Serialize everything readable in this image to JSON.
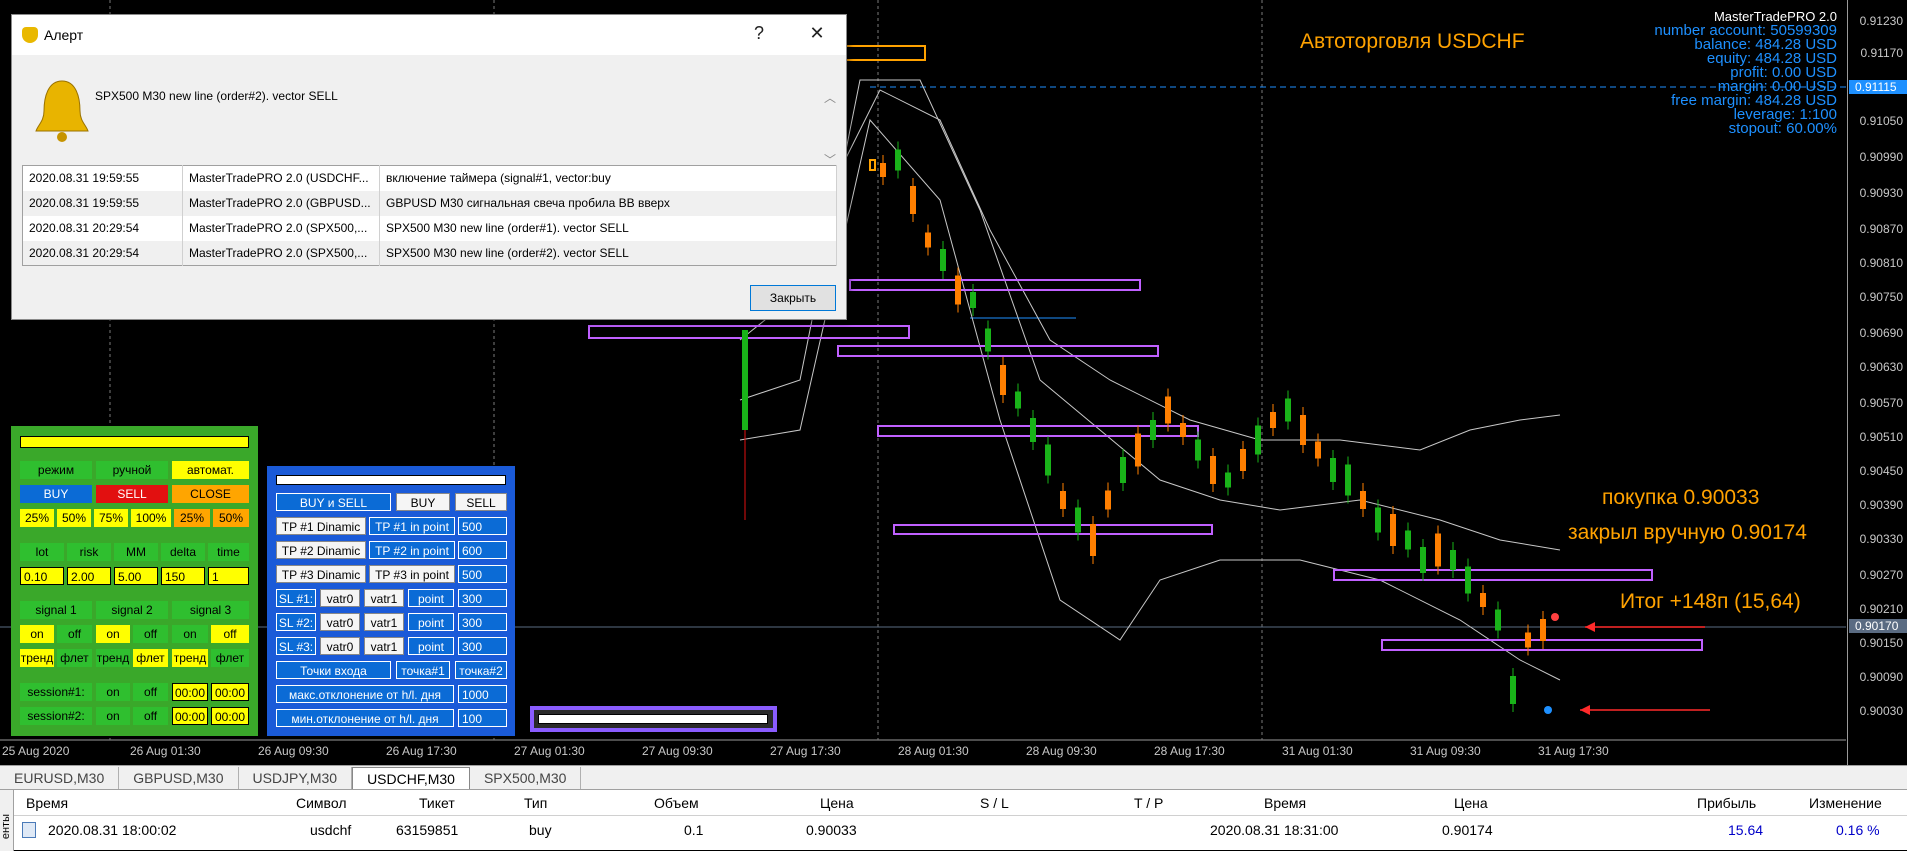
{
  "chart": {
    "title_overlay": "Автоторговля USDCHF",
    "window_title_fragment": "USDCHF,M30",
    "price_labels": [
      "0.91230",
      "0.91170",
      "0.91115",
      "0.91050",
      "0.90990",
      "0.90930",
      "0.90870",
      "0.90810",
      "0.90750",
      "0.90690",
      "0.90630",
      "0.90570",
      "0.90510",
      "0.90450",
      "0.90390",
      "0.90330",
      "0.90270",
      "0.90210",
      "0.90170",
      "0.90150",
      "0.90090",
      "0.90030"
    ],
    "price_marker_top": "0.91115",
    "price_marker_bottom": "0.90170",
    "time_labels": [
      "25 Aug 2020",
      "26 Aug 01:30",
      "26 Aug 09:30",
      "26 Aug 17:30",
      "27 Aug 01:30",
      "27 Aug 09:30",
      "27 Aug 17:30",
      "28 Aug 01:30",
      "28 Aug 09:30",
      "28 Aug 17:30",
      "31 Aug 01:30",
      "31 Aug 09:30",
      "31 Aug 17:30"
    ],
    "annotations": {
      "buy": "покупка 0.90033",
      "closed": "закрыл вручную 0.90174",
      "result": "Итог +148п (15,64)"
    },
    "colors": {
      "bull": "#19b319",
      "bear": "#ff7f00",
      "zone": "#c060ff",
      "band": "#c8c8c8",
      "overlay": "#ffa200",
      "info": "#1e90ff"
    }
  },
  "account": {
    "header": "MasterTradePRO 2.0",
    "lines": [
      "number account: 50599309",
      "balance: 484.28 USD",
      "equity: 484.28 USD",
      "profit: 0.00 USD",
      "margin: 0.00 USD",
      "free margin: 484.28 USD",
      "leverage: 1:100",
      "stopout: 60.00%"
    ]
  },
  "alert_dialog": {
    "title": "Алерт",
    "help": "?",
    "close": "✕",
    "message": "SPX500 M30 new line (order#2). vector SELL",
    "rows": [
      [
        "2020.08.31 19:59:55",
        "MasterTradePRO 2.0 (USDCHF...",
        "включение таймера (signal#1, vector:buy"
      ],
      [
        "2020.08.31 19:59:55",
        "MasterTradePRO 2.0 (GBPUSD...",
        "GBPUSD M30 сигнальная свеча пробила BB вверх"
      ],
      [
        "2020.08.31 20:29:54",
        "MasterTradePRO 2.0 (SPX500,...",
        "SPX500 M30 new line (order#1). vector SELL"
      ],
      [
        "2020.08.31 20:29:54",
        "MasterTradePRO 2.0 (SPX500,...",
        "SPX500 M30 new line (order#2). vector SELL"
      ]
    ],
    "close_button": "Закрыть"
  },
  "left_panel": {
    "mode": [
      "режим",
      "ручной",
      "автомат."
    ],
    "actions": [
      "BUY",
      "SELL",
      "CLOSE"
    ],
    "pct": [
      "25%",
      "50%",
      "75%",
      "100%",
      "25%",
      "50%"
    ],
    "params_labels": [
      "lot",
      "risk",
      "MM",
      "delta",
      "time"
    ],
    "params_values": [
      "0.10",
      "2.00",
      "5.00",
      "150",
      "1"
    ],
    "signals": [
      "signal 1",
      "signal 2",
      "signal 3"
    ],
    "on": "on",
    "off": "off",
    "trend": "тренд",
    "flat": "флет",
    "sessions": [
      "session#1:",
      "session#2:"
    ],
    "time_zero": "00:00"
  },
  "right_panel": {
    "top_buttons": [
      "BUY и SELL",
      "BUY",
      "SELL"
    ],
    "tp_rows": [
      [
        "TP #1 Dinamic",
        "TP #1 in point",
        "500"
      ],
      [
        "TP #2 Dinamic",
        "TP #2 in point",
        "600"
      ],
      [
        "TP #3 Dinamic",
        "TP #3 in point",
        "500"
      ]
    ],
    "sl_rows": [
      [
        "SL #1:",
        "vatr0",
        "vatr1",
        "point",
        "300"
      ],
      [
        "SL #2:",
        "vatr0",
        "vatr1",
        "point",
        "300"
      ],
      [
        "SL #3:",
        "vatr0",
        "vatr1",
        "point",
        "300"
      ]
    ],
    "entry": [
      "Точки входа",
      "точка#1",
      "точка#2"
    ],
    "max_dev": [
      "макс.отклонение от h/l. дня",
      "1000"
    ],
    "min_dev": [
      "мин.отклонение от h/l. дня",
      "100"
    ]
  },
  "tabs": [
    "EURUSD,M30",
    "GBPUSD,M30",
    "USDJPY,M30",
    "USDCHF,M30",
    "SPX500,M30"
  ],
  "active_tab": "USDCHF,M30",
  "history": {
    "headers": [
      "Время",
      "Символ",
      "Тикет",
      "Тип",
      "Объем",
      "Цена",
      "S / L",
      "T / P",
      "Время",
      "Цена",
      "Прибыль",
      "Изменение"
    ],
    "row": [
      "2020.08.31 18:00:02",
      "usdchf",
      "63159851",
      "buy",
      "0.1",
      "0.90033",
      "",
      "",
      "2020.08.31 18:31:00",
      "0.90174",
      "15.64",
      "0.16 %"
    ],
    "side_label": "енты"
  }
}
